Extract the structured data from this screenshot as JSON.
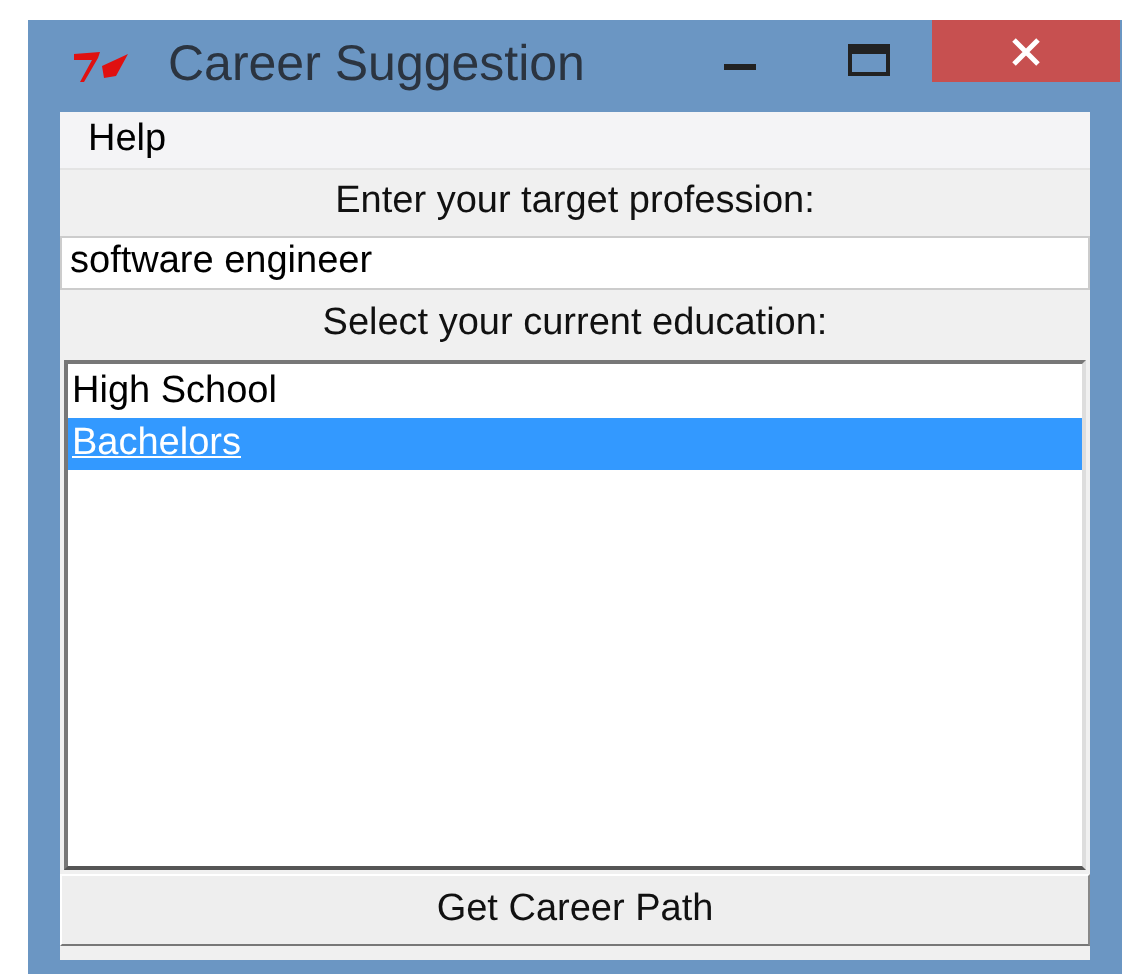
{
  "window": {
    "title": "Career Suggestion"
  },
  "menu": [
    {
      "label": "Help"
    }
  ],
  "profession_label": "Enter your target profession:",
  "profession_field": {
    "value": "software engineer"
  },
  "education_label": "Select your current education:",
  "education_list": [
    {
      "label": "High School",
      "selected": false
    },
    {
      "label": "Bachelors",
      "selected": true
    }
  ],
  "button": "Get Career Path"
}
